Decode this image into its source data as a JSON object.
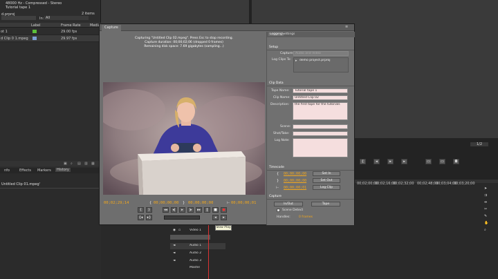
{
  "project": {
    "audio_info": "48000 Hz - Compressed - Stereo",
    "tape_info": "Tutorial tape 1",
    "project_name": "d.prproj",
    "items_count": "2 items",
    "in_label": "In:",
    "in_value": "All",
    "columns": [
      "Label",
      "Frame Rate",
      "Media"
    ],
    "rows": [
      {
        "name": "ot 1",
        "rate": "29.00 fps",
        "color": "#5cbf3a"
      },
      {
        "name": "d Clip 0 1.mpeg",
        "rate": "29.97 fps",
        "color": "#7d9fd6"
      }
    ],
    "tabs": [
      "nfo",
      "Effects",
      "Markers",
      "History"
    ],
    "clip_label": "Untitled Clip 01.mpeg'"
  },
  "capture": {
    "tab": "Capture",
    "status_lines": [
      "Capturing \"Untitled Clip 02.mpeg\". Press Esc to stop recording.",
      "Capture duration: 00;00;02;06  (dropped 0 frames)",
      "Remaining disk space: 7.69 gigabytes (sampling...)"
    ],
    "timecodes": {
      "current": "00;02;29;14",
      "tc2": "00;00;00;00",
      "tc3": "00;00;00;00",
      "tc4": "00;00;00;01"
    },
    "logging_tab": "Logging",
    "settings_tab": "Settings",
    "setup": {
      "header": "Setup",
      "capture_label": "Capture:",
      "capture_value": "Audio and Video",
      "log_clips_label": "Log Clips To:",
      "log_clips_value": "demo project.prproj"
    },
    "clip_data": {
      "header": "Clip Data",
      "tape_name_label": "Tape Name:",
      "tape_name": "Tutorial tape 1",
      "clip_name_label": "Clip Name:",
      "clip_name": "Untitled Clip 02",
      "description_label": "Description:",
      "description": "the first tape for the tutorials",
      "scene_label": "Scene:",
      "shot_label": "Shot/Take:",
      "log_note_label": "Log Note:"
    },
    "timecode": {
      "header": "Timecode",
      "in": "00;00;00;00",
      "out": "00;00;00;00",
      "dur": "00;00;00;01",
      "set_in": "Set In",
      "set_out": "Set Out",
      "log_clip": "Log Clip"
    },
    "capture_section": {
      "header": "Capture",
      "in_out": "In/Out",
      "tape": "Tape",
      "scene_detect": "Scene Detect",
      "handles_label": "Handles:",
      "handles_value": "0 frames"
    }
  },
  "timeline": {
    "ruler": [
      "00;02;00;00",
      "00;02;16;00",
      "00;02;32;00",
      "00;02;48;00",
      "00;03;04;00",
      "00;03;20;00"
    ],
    "tracks": [
      "Video 1",
      "Audio 1",
      "Audio 2",
      "Audio 3",
      "Master"
    ]
  },
  "zoom_value": "1/2",
  "tooltip": "Slow Play"
}
